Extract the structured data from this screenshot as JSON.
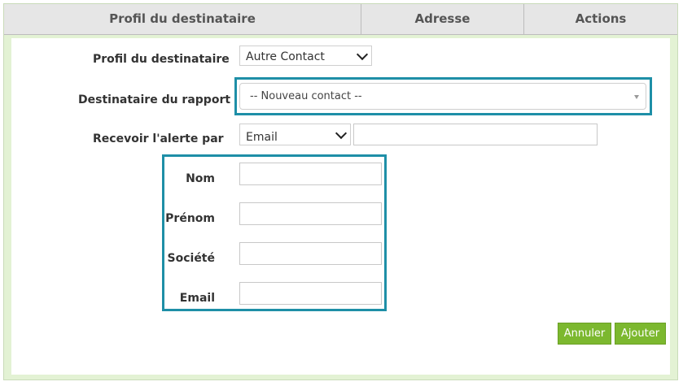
{
  "header": {
    "col1": "Profil du destinataire",
    "col2": "Adresse",
    "col3": "Actions"
  },
  "form": {
    "profil_label": "Profil du destinataire",
    "profil_value": "Autre Contact",
    "destinataire_label": "Destinataire du rapport",
    "destinataire_value": "-- Nouveau contact --",
    "alerte_label": "Recevoir l'alerte par",
    "alerte_value": "Email",
    "nom_label": "Nom",
    "prenom_label": "Prénom",
    "societe_label": "Société",
    "email_label": "Email"
  },
  "buttons": {
    "cancel": "Annuler",
    "add": "Ajouter"
  },
  "colors": {
    "highlight": "#1e8fa7",
    "button": "#7cb82f",
    "frame": "#e3f2d4"
  }
}
